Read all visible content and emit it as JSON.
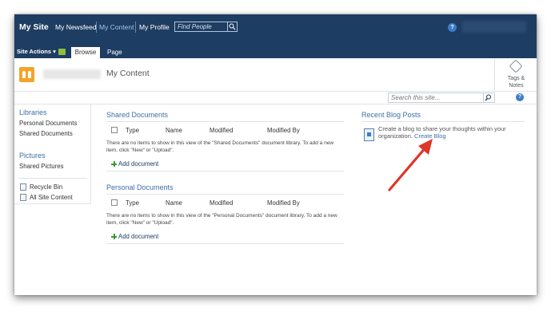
{
  "top_nav": {
    "site_title": "My Site",
    "newsfeed": "My Newsfeed",
    "my_content": "My Content",
    "my_profile": "My Profile",
    "search_placeholder": "Find People",
    "help": "?"
  },
  "ribbon": {
    "site_actions": "Site Actions ▾",
    "tab_browse": "Browse",
    "tab_page": "Page"
  },
  "header": {
    "page_title": "My Content",
    "tags_notes": "Tags &\nNotes"
  },
  "site_search": {
    "placeholder": "Search this site...",
    "help": "?"
  },
  "left_nav": {
    "libraries_heading": "Libraries",
    "personal_documents": "Personal Documents",
    "shared_documents": "Shared Documents",
    "pictures_heading": "Pictures",
    "shared_pictures": "Shared Pictures",
    "recycle_bin": "Recycle Bin",
    "all_site_content": "All Site Content"
  },
  "shared_documents": {
    "title": "Shared Documents",
    "columns": [
      "Type",
      "Name",
      "Modified",
      "Modified By"
    ],
    "empty_text": "There are no items to show in this view of the \"Shared Documents\" document library. To add a new item, click \"New\" or \"Upload\".",
    "add_document": "Add document"
  },
  "personal_documents": {
    "title": "Personal Documents",
    "columns": [
      "Type",
      "Name",
      "Modified",
      "Modified By"
    ],
    "empty_text": "There are no items to show in this view of the \"Personal Documents\" document library. To add a new item, click \"New\" or \"Upload\".",
    "add_document": "Add document"
  },
  "blog": {
    "title": "Recent Blog Posts",
    "text": "Create a blog to share your thoughts within your organization.",
    "link": "Create Blog"
  },
  "colors": {
    "top_bar": "#1e3d62",
    "link_blue": "#3d6fa8",
    "arrow_red": "#e0352b",
    "logo_orange": "#f4a32a"
  }
}
